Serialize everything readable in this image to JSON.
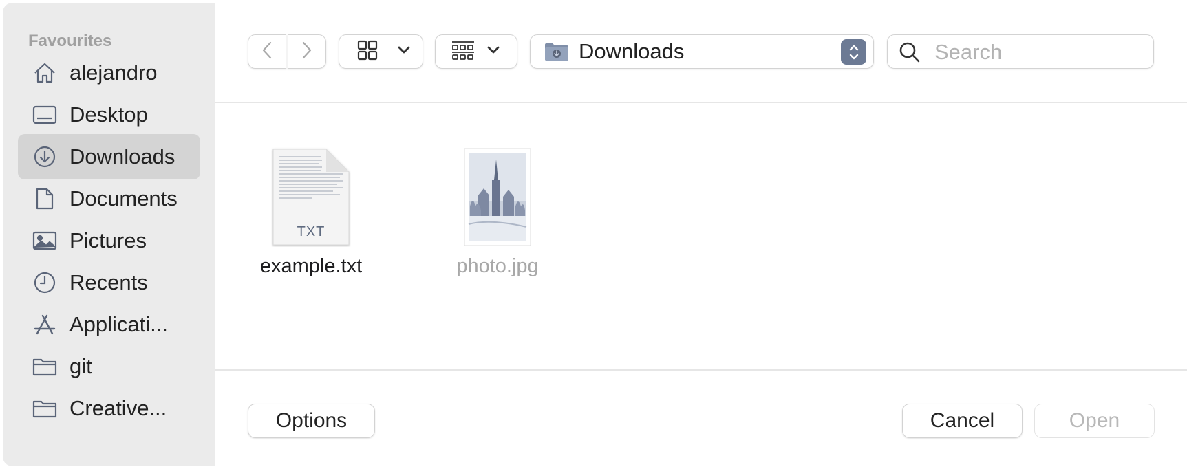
{
  "sidebar": {
    "heading": "Favourites",
    "items": [
      {
        "label": "alejandro",
        "icon": "home-icon"
      },
      {
        "label": "Desktop",
        "icon": "desktop-icon"
      },
      {
        "label": "Downloads",
        "icon": "downloads-icon",
        "selected": true
      },
      {
        "label": "Documents",
        "icon": "document-icon"
      },
      {
        "label": "Pictures",
        "icon": "pictures-icon"
      },
      {
        "label": "Recents",
        "icon": "clock-icon"
      },
      {
        "label": "Applicati...",
        "icon": "applications-icon"
      },
      {
        "label": "git",
        "icon": "folder-icon"
      },
      {
        "label": "Creative...",
        "icon": "folder-icon"
      }
    ]
  },
  "toolbar": {
    "back_icon": "chevron-left-icon",
    "forward_icon": "chevron-right-icon",
    "view_mode_icon": "grid-view-icon",
    "group_icon": "group-by-icon",
    "location": "Downloads",
    "location_icon": "downloads-folder-icon",
    "search_placeholder": "Search",
    "search_value": ""
  },
  "files": [
    {
      "name": "example.txt",
      "badge": "TXT",
      "type": "text",
      "enabled": true
    },
    {
      "name": "photo.jpg",
      "type": "image",
      "enabled": false
    }
  ],
  "footer": {
    "options_label": "Options",
    "cancel_label": "Cancel",
    "open_label": "Open"
  },
  "colors": {
    "sidebar_bg": "#ebebeb",
    "selected_bg": "#d4d4d4",
    "icon_color": "#5a6478",
    "stepper_bg": "#6c7a94"
  }
}
